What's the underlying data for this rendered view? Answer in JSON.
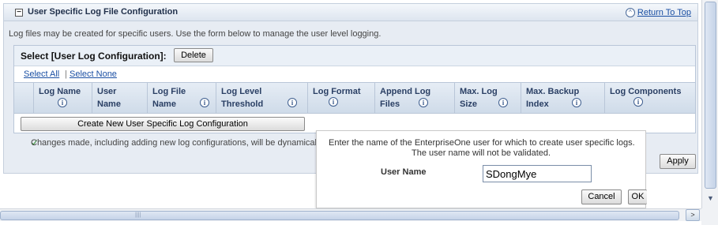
{
  "section": {
    "title": "User Specific Log File Configuration",
    "top_link": "Return To Top",
    "description": "Log files may be created for specific users. Use the form below to manage the user level logging."
  },
  "grid": {
    "select_label": "Select [User Log Configuration]:",
    "delete_label": "Delete",
    "select_all": "Select All",
    "select_none": "Select None",
    "separator": "|",
    "columns": [
      {
        "l1": "Log Name",
        "l2": ""
      },
      {
        "l1": "User",
        "l2": "Name"
      },
      {
        "l1": "Log File",
        "l2": "Name"
      },
      {
        "l1": "Log Level",
        "l2": "Threshold"
      },
      {
        "l1": "Log Format",
        "l2": ""
      },
      {
        "l1": "Append Log",
        "l2": "Files"
      },
      {
        "l1": "Max. Log",
        "l2": "Size"
      },
      {
        "l1": "Max. Backup",
        "l2": "Index"
      },
      {
        "l1": "Log Components",
        "l2": ""
      }
    ],
    "create_label": "Create New User Specific Log Configuration"
  },
  "note": "Changes made, including adding new log configurations, will be dynamically re",
  "apply_label": "Apply",
  "popup": {
    "line1": "Enter the name of the EnterpriseOne user for which to create user specific logs.",
    "line2": "The user name will not be validated.",
    "user_label": "User Name",
    "user_value": "SDongMye",
    "cancel_label": "Cancel",
    "ok_label": "OK"
  },
  "icons": {
    "collapse": "minus-box-icon",
    "top": "up-chevron-icon",
    "info": "info-icon",
    "check": "checkmark-icon",
    "scroll_down": "down-arrow-icon",
    "scroll_right": "right-arrow-icon"
  },
  "colors": {
    "link": "#1a4fa3",
    "panel_bg": "#e7ecf3",
    "header_text": "#2a3f64"
  }
}
